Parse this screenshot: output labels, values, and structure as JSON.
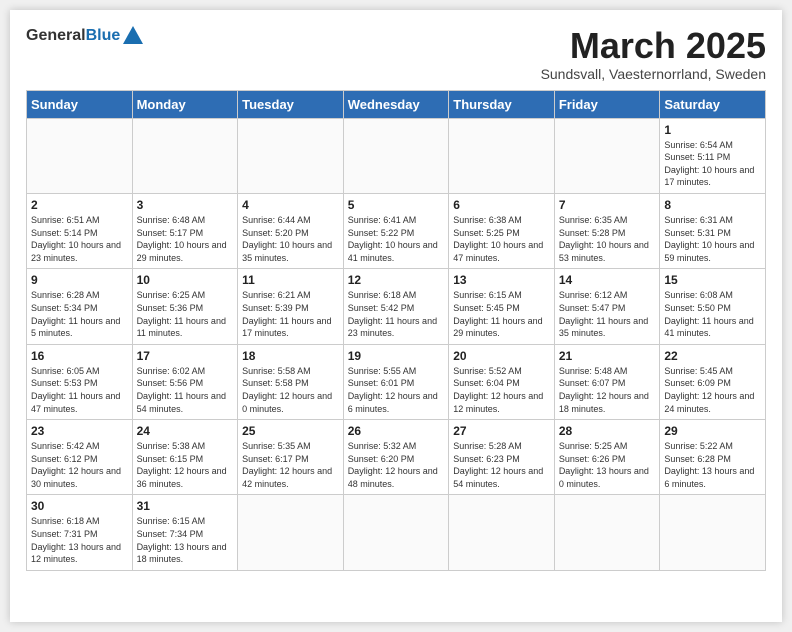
{
  "header": {
    "logo_general": "General",
    "logo_blue": "Blue",
    "month_title": "March 2025",
    "subtitle": "Sundsvall, Vaesternorrland, Sweden"
  },
  "weekdays": [
    "Sunday",
    "Monday",
    "Tuesday",
    "Wednesday",
    "Thursday",
    "Friday",
    "Saturday"
  ],
  "weeks": [
    [
      {
        "day": "",
        "info": ""
      },
      {
        "day": "",
        "info": ""
      },
      {
        "day": "",
        "info": ""
      },
      {
        "day": "",
        "info": ""
      },
      {
        "day": "",
        "info": ""
      },
      {
        "day": "",
        "info": ""
      },
      {
        "day": "1",
        "info": "Sunrise: 6:54 AM\nSunset: 5:11 PM\nDaylight: 10 hours\nand 17 minutes."
      }
    ],
    [
      {
        "day": "2",
        "info": "Sunrise: 6:51 AM\nSunset: 5:14 PM\nDaylight: 10 hours\nand 23 minutes."
      },
      {
        "day": "3",
        "info": "Sunrise: 6:48 AM\nSunset: 5:17 PM\nDaylight: 10 hours\nand 29 minutes."
      },
      {
        "day": "4",
        "info": "Sunrise: 6:44 AM\nSunset: 5:20 PM\nDaylight: 10 hours\nand 35 minutes."
      },
      {
        "day": "5",
        "info": "Sunrise: 6:41 AM\nSunset: 5:22 PM\nDaylight: 10 hours\nand 41 minutes."
      },
      {
        "day": "6",
        "info": "Sunrise: 6:38 AM\nSunset: 5:25 PM\nDaylight: 10 hours\nand 47 minutes."
      },
      {
        "day": "7",
        "info": "Sunrise: 6:35 AM\nSunset: 5:28 PM\nDaylight: 10 hours\nand 53 minutes."
      },
      {
        "day": "8",
        "info": "Sunrise: 6:31 AM\nSunset: 5:31 PM\nDaylight: 10 hours\nand 59 minutes."
      }
    ],
    [
      {
        "day": "9",
        "info": "Sunrise: 6:28 AM\nSunset: 5:34 PM\nDaylight: 11 hours\nand 5 minutes."
      },
      {
        "day": "10",
        "info": "Sunrise: 6:25 AM\nSunset: 5:36 PM\nDaylight: 11 hours\nand 11 minutes."
      },
      {
        "day": "11",
        "info": "Sunrise: 6:21 AM\nSunset: 5:39 PM\nDaylight: 11 hours\nand 17 minutes."
      },
      {
        "day": "12",
        "info": "Sunrise: 6:18 AM\nSunset: 5:42 PM\nDaylight: 11 hours\nand 23 minutes."
      },
      {
        "day": "13",
        "info": "Sunrise: 6:15 AM\nSunset: 5:45 PM\nDaylight: 11 hours\nand 29 minutes."
      },
      {
        "day": "14",
        "info": "Sunrise: 6:12 AM\nSunset: 5:47 PM\nDaylight: 11 hours\nand 35 minutes."
      },
      {
        "day": "15",
        "info": "Sunrise: 6:08 AM\nSunset: 5:50 PM\nDaylight: 11 hours\nand 41 minutes."
      }
    ],
    [
      {
        "day": "16",
        "info": "Sunrise: 6:05 AM\nSunset: 5:53 PM\nDaylight: 11 hours\nand 47 minutes."
      },
      {
        "day": "17",
        "info": "Sunrise: 6:02 AM\nSunset: 5:56 PM\nDaylight: 11 hours\nand 54 minutes."
      },
      {
        "day": "18",
        "info": "Sunrise: 5:58 AM\nSunset: 5:58 PM\nDaylight: 12 hours\nand 0 minutes."
      },
      {
        "day": "19",
        "info": "Sunrise: 5:55 AM\nSunset: 6:01 PM\nDaylight: 12 hours\nand 6 minutes."
      },
      {
        "day": "20",
        "info": "Sunrise: 5:52 AM\nSunset: 6:04 PM\nDaylight: 12 hours\nand 12 minutes."
      },
      {
        "day": "21",
        "info": "Sunrise: 5:48 AM\nSunset: 6:07 PM\nDaylight: 12 hours\nand 18 minutes."
      },
      {
        "day": "22",
        "info": "Sunrise: 5:45 AM\nSunset: 6:09 PM\nDaylight: 12 hours\nand 24 minutes."
      }
    ],
    [
      {
        "day": "23",
        "info": "Sunrise: 5:42 AM\nSunset: 6:12 PM\nDaylight: 12 hours\nand 30 minutes."
      },
      {
        "day": "24",
        "info": "Sunrise: 5:38 AM\nSunset: 6:15 PM\nDaylight: 12 hours\nand 36 minutes."
      },
      {
        "day": "25",
        "info": "Sunrise: 5:35 AM\nSunset: 6:17 PM\nDaylight: 12 hours\nand 42 minutes."
      },
      {
        "day": "26",
        "info": "Sunrise: 5:32 AM\nSunset: 6:20 PM\nDaylight: 12 hours\nand 48 minutes."
      },
      {
        "day": "27",
        "info": "Sunrise: 5:28 AM\nSunset: 6:23 PM\nDaylight: 12 hours\nand 54 minutes."
      },
      {
        "day": "28",
        "info": "Sunrise: 5:25 AM\nSunset: 6:26 PM\nDaylight: 13 hours\nand 0 minutes."
      },
      {
        "day": "29",
        "info": "Sunrise: 5:22 AM\nSunset: 6:28 PM\nDaylight: 13 hours\nand 6 minutes."
      }
    ],
    [
      {
        "day": "30",
        "info": "Sunrise: 6:18 AM\nSunset: 7:31 PM\nDaylight: 13 hours\nand 12 minutes."
      },
      {
        "day": "31",
        "info": "Sunrise: 6:15 AM\nSunset: 7:34 PM\nDaylight: 13 hours\nand 18 minutes."
      },
      {
        "day": "",
        "info": ""
      },
      {
        "day": "",
        "info": ""
      },
      {
        "day": "",
        "info": ""
      },
      {
        "day": "",
        "info": ""
      },
      {
        "day": "",
        "info": ""
      }
    ]
  ]
}
